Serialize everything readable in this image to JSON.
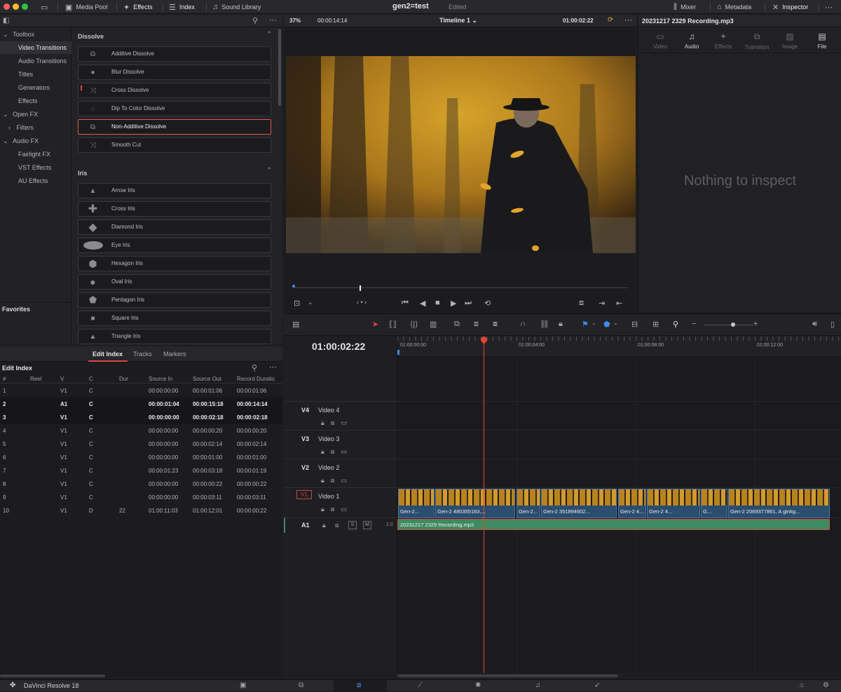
{
  "topbar": {
    "media_pool": "Media Pool",
    "effects": "Effects",
    "index": "Index",
    "sound_library": "Sound Library",
    "project_name": "gen2=test",
    "project_status": "Edited",
    "mixer": "Mixer",
    "metadata": "Metadata",
    "inspector": "Inspector"
  },
  "sidebar": {
    "toolbox": "Toolbox",
    "video_transitions": "Video Transitions",
    "audio_transitions": "Audio Transitions",
    "titles": "Titles",
    "generators": "Generators",
    "effects": "Effects",
    "open_fx": "Open FX",
    "filters": "Filters",
    "audio_fx": "Audio FX",
    "fairlight_fx": "Fairlight FX",
    "vst_effects": "VST Effects",
    "au_effects": "AU Effects",
    "favorites": "Favorites"
  },
  "dissolve": {
    "header": "Dissolve",
    "items": [
      "Additive Dissolve",
      "Blur Dissolve",
      "Cross Dissolve",
      "Dip To Color Dissolve",
      "Non-Additive Dissolve",
      "Smooth Cut"
    ]
  },
  "iris": {
    "header": "Iris",
    "items": [
      "Arrow Iris",
      "Cross Iris",
      "Diamond Iris",
      "Eye Iris",
      "Hexagon Iris",
      "Oval Iris",
      "Pentagon Iris",
      "Square Iris",
      "Triangle Iris"
    ]
  },
  "edit_index": {
    "tabs": [
      "Edit Index",
      "Tracks",
      "Markers"
    ],
    "title": "Edit Index",
    "columns": [
      "#",
      "Reel",
      "V",
      "C",
      "Dur",
      "Source In",
      "Source Out",
      "Record Duratio"
    ],
    "rows": [
      [
        "1",
        "V1",
        "C",
        "",
        "00:00:00:00",
        "00:00:01:06",
        "00:00:01:06"
      ],
      [
        "2",
        "A1",
        "C",
        "",
        "00:00:01:04",
        "00:00:15:18",
        "00:00:14:14"
      ],
      [
        "3",
        "V1",
        "C",
        "",
        "00:00:00:00",
        "00:00:02:18",
        "00:00:02:18"
      ],
      [
        "4",
        "V1",
        "C",
        "",
        "00:00:00:00",
        "00:00:00:20",
        "00:00:00:20"
      ],
      [
        "5",
        "V1",
        "C",
        "",
        "00:00:00:00",
        "00:00:02:14",
        "00:00:02:14"
      ],
      [
        "6",
        "V1",
        "C",
        "",
        "00:00:00:00",
        "00:00:01:00",
        "00:00:01:00"
      ],
      [
        "7",
        "V1",
        "C",
        "",
        "00:00:01:23",
        "00:00:03:18",
        "00:00:01:19"
      ],
      [
        "8",
        "V1",
        "C",
        "",
        "00:00:00:00",
        "00:00:00:22",
        "00:00:00:22"
      ],
      [
        "9",
        "V1",
        "C",
        "",
        "00:00:00:00",
        "00:00:03:11",
        "00:00:03:11"
      ],
      [
        "10",
        "V1",
        "D",
        "22",
        "01:00:11:03",
        "01:00:12:01",
        "00:00:00:22"
      ]
    ]
  },
  "viewer": {
    "zoom": "37%",
    "duration": "00:00:14:14",
    "timeline_name": "Timeline 1",
    "timecode": "01:00:02:22"
  },
  "inspector": {
    "clip_name": "20231217 2329 Recording.mp3",
    "tabs": [
      "Video",
      "Audio",
      "Effects",
      "Transition",
      "Image",
      "File"
    ],
    "empty_message": "Nothing to inspect"
  },
  "timeline": {
    "timecode": "01:00:02:22",
    "ruler": [
      "01:00:00:00",
      "01:00:04:00",
      "01:00:08:00",
      "01:00:12:00"
    ],
    "tracks": [
      {
        "id": "V4",
        "name": "Video 4"
      },
      {
        "id": "V3",
        "name": "Video 3"
      },
      {
        "id": "V2",
        "name": "Video 2"
      },
      {
        "id": "V1",
        "name": "Video 1"
      }
    ],
    "audio_track": {
      "id": "A1",
      "level": "2.0",
      "solo": "S",
      "mute": "M"
    },
    "video_clips": [
      "Gen-2...",
      "Gen-2 480355163,...",
      "Gen-2...",
      "Gen-2 351894602...",
      "Gen-2 4...",
      "G...",
      "Gen-2 2069377861, A ginkg..."
    ],
    "audio_clip": "20231217 2329 Recording.mp3"
  },
  "bottombar": {
    "app_name": "DaVinci Resolve 18"
  }
}
